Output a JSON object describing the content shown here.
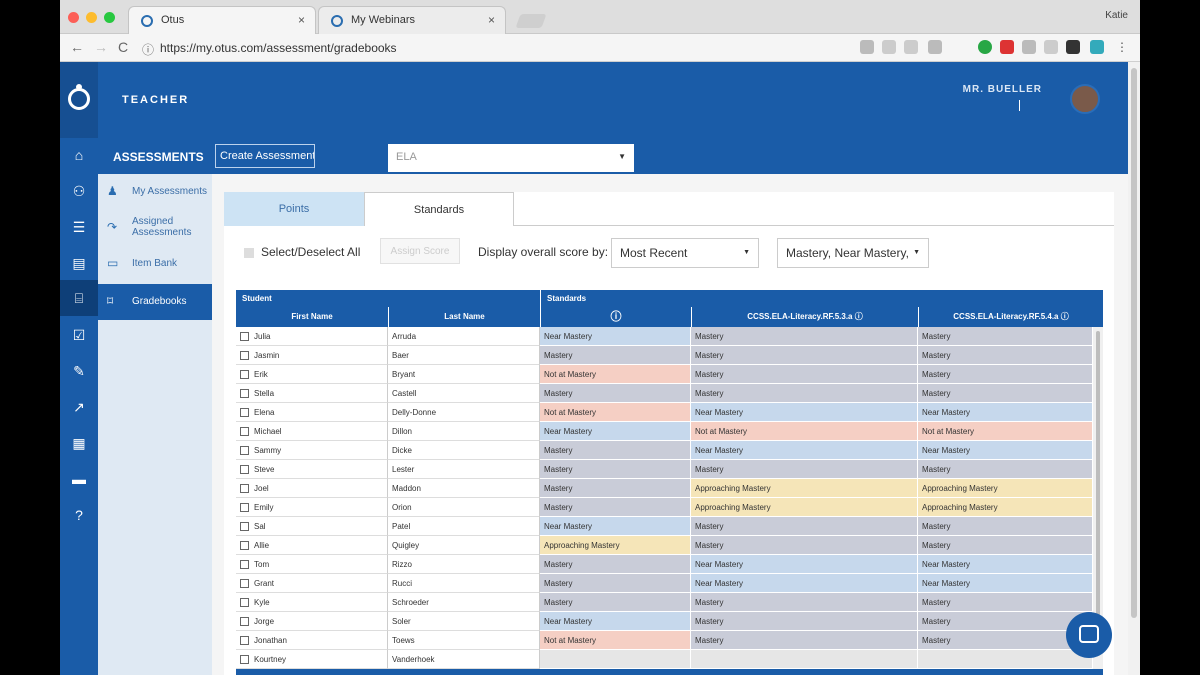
{
  "browser": {
    "tabs": [
      {
        "title": "Otus",
        "close": "×",
        "active": true
      },
      {
        "title": "My Webinars",
        "close": "×",
        "active": false
      }
    ],
    "profile": "Katie",
    "url": "https://my.otus.com/assessment/gradebooks",
    "nav": {
      "back": "←",
      "forward": "→",
      "reload": "C",
      "info": "ⓘ"
    }
  },
  "app": {
    "role_label": "TEACHER",
    "user_name": "MR. BUELLER",
    "section_title": "ASSESSMENTS",
    "create_button": "Create Assessment",
    "subject_select": {
      "value": "ELA",
      "caret": "▼"
    },
    "rail_icons": [
      "home-icon",
      "users-icon",
      "list-icon",
      "book-icon",
      "institution-icon",
      "check-icon",
      "pencil-icon",
      "chart-icon",
      "calendar-icon",
      "briefcase-icon",
      "help-icon"
    ],
    "rail_glyphs": [
      "⌂",
      "⚇",
      "☰",
      "▤",
      "⌸",
      "☑",
      "✎",
      "↗",
      "▦",
      "▬",
      "?"
    ],
    "subnav": [
      {
        "label": "My Assessments",
        "icon": "user-icon",
        "glyph": "♟"
      },
      {
        "label": "Assigned Assessments",
        "icon": "share-icon",
        "glyph": "↷"
      },
      {
        "label": "Item Bank",
        "icon": "bank-icon",
        "glyph": "▭"
      },
      {
        "label": "Gradebooks",
        "icon": "bookmark-icon",
        "glyph": "⌑",
        "selected": true
      }
    ],
    "tabs": {
      "points": "Points",
      "standards": "Standards"
    },
    "controls": {
      "select_all": "Select/Deselect All",
      "grey_button": "Assign Score",
      "display_label": "Display overall score by:",
      "score_mode": {
        "value": "Most Recent",
        "caret": "▼"
      },
      "filter": {
        "value": "Mastery, Near Mastery,",
        "caret": "▼"
      }
    },
    "grid": {
      "group_student": "Student",
      "group_standards": "Standards",
      "col_first": "First Name",
      "col_last": "Last Name",
      "col_overall_icon": "ⓘ",
      "col_std1": "CCSS.ELA-Literacy.RF.5.3.a ⓘ",
      "col_std2": "CCSS.ELA-Literacy.RF.5.4.a ⓘ",
      "rows": [
        {
          "first": "Julia",
          "last": "Arruda",
          "overall": "Near Mastery",
          "s1": "Mastery",
          "s2": "Mastery"
        },
        {
          "first": "Jasmin",
          "last": "Baer",
          "overall": "Mastery",
          "s1": "Mastery",
          "s2": "Mastery"
        },
        {
          "first": "Erik",
          "last": "Bryant",
          "overall": "Not at Mastery",
          "s1": "Mastery",
          "s2": "Mastery"
        },
        {
          "first": "Stella",
          "last": "Castell",
          "overall": "Mastery",
          "s1": "Mastery",
          "s2": "Mastery"
        },
        {
          "first": "Elena",
          "last": "Delly-Donne",
          "overall": "Not at Mastery",
          "s1": "Near Mastery",
          "s2": "Near Mastery"
        },
        {
          "first": "Michael",
          "last": "Dillon",
          "overall": "Near Mastery",
          "s1": "Not at Mastery",
          "s2": "Not at Mastery"
        },
        {
          "first": "Sammy",
          "last": "Dicke",
          "overall": "Mastery",
          "s1": "Near Mastery",
          "s2": "Near Mastery"
        },
        {
          "first": "Steve",
          "last": "Lester",
          "overall": "Mastery",
          "s1": "Mastery",
          "s2": "Mastery"
        },
        {
          "first": "Joel",
          "last": "Maddon",
          "overall": "Mastery",
          "s1": "Approaching Mastery",
          "s2": "Approaching Mastery"
        },
        {
          "first": "Emily",
          "last": "Orion",
          "overall": "Mastery",
          "s1": "Approaching Mastery",
          "s2": "Approaching Mastery"
        },
        {
          "first": "Sal",
          "last": "Patel",
          "overall": "Near Mastery",
          "s1": "Mastery",
          "s2": "Mastery"
        },
        {
          "first": "Allie",
          "last": "Quigley",
          "overall": "Approaching Mastery",
          "s1": "Mastery",
          "s2": "Mastery"
        },
        {
          "first": "Tom",
          "last": "Rizzo",
          "overall": "Mastery",
          "s1": "Near Mastery",
          "s2": "Near Mastery"
        },
        {
          "first": "Grant",
          "last": "Rucci",
          "overall": "Mastery",
          "s1": "Near Mastery",
          "s2": "Near Mastery"
        },
        {
          "first": "Kyle",
          "last": "Schroeder",
          "overall": "Mastery",
          "s1": "Mastery",
          "s2": "Mastery"
        },
        {
          "first": "Jorge",
          "last": "Soler",
          "overall": "Near Mastery",
          "s1": "Mastery",
          "s2": "Mastery"
        },
        {
          "first": "Jonathan",
          "last": "Toews",
          "overall": "Not at Mastery",
          "s1": "Mastery",
          "s2": "Mastery"
        },
        {
          "first": "Kourtney",
          "last": "Vanderhoek",
          "overall": "",
          "s1": "",
          "s2": ""
        }
      ],
      "footer_icons": [
        "✕",
        "↔",
        "↻"
      ]
    },
    "colors": {
      "brand": "#1a5ca8",
      "Mastery": "#c9ccd8",
      "Near Mastery": "#c6d8ec",
      "Not at Mastery": "#f5cfc4",
      "Approaching Mastery": "#f5e5b8"
    }
  }
}
